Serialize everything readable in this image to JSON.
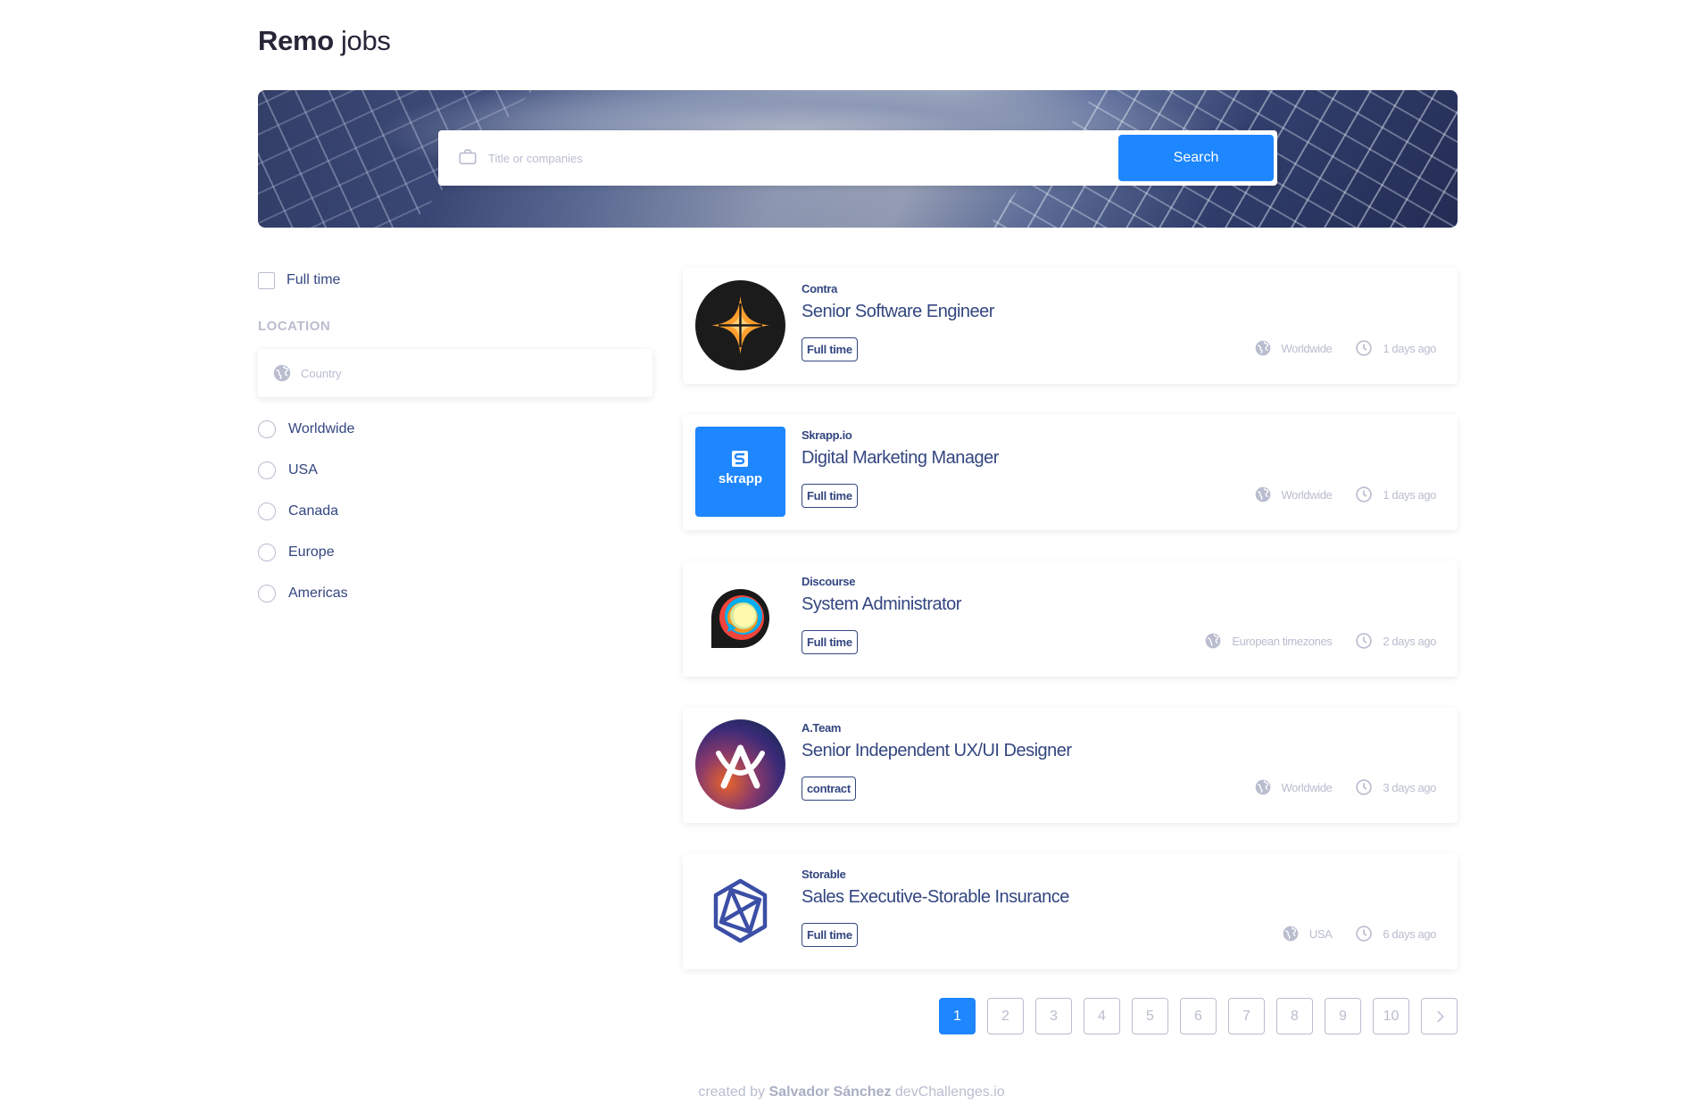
{
  "app": {
    "logo_bold": "Remo",
    "logo_light": "jobs"
  },
  "search": {
    "placeholder": "Title or companies",
    "button_label": "Search"
  },
  "filters": {
    "full_time_label": "Full time",
    "location_title": "LOCATION",
    "country_placeholder": "Country",
    "locations": [
      "Worldwide",
      "USA",
      "Canada",
      "Europe",
      "Americas"
    ]
  },
  "jobs": [
    {
      "company": "Contra",
      "title": "Senior Software Engineer",
      "tag": "Full time",
      "location": "Worldwide",
      "posted": "1  days ago",
      "logo": "contra-logo"
    },
    {
      "company": "Skrapp.io",
      "title": "Digital Marketing Manager",
      "tag": "Full time",
      "location": "Worldwide",
      "posted": "1  days ago",
      "logo": "skrapp-logo",
      "logo_text": "skrapp"
    },
    {
      "company": "Discourse",
      "title": "System Administrator",
      "tag": "Full time",
      "location": "European timezones",
      "posted": "2  days ago",
      "logo": "discourse-logo"
    },
    {
      "company": "A.Team",
      "title": "Senior Independent UX/UI Designer",
      "tag": "contract",
      "location": "Worldwide",
      "posted": "3  days ago",
      "logo": "ateam-logo"
    },
    {
      "company": "Storable",
      "title": "Sales Executive-Storable Insurance",
      "tag": "Full time",
      "location": "USA",
      "posted": "6  days ago",
      "logo": "storable-logo"
    }
  ],
  "pagination": {
    "pages": [
      "1",
      "2",
      "3",
      "4",
      "5",
      "6",
      "7",
      "8",
      "9",
      "10"
    ],
    "current": "1"
  },
  "footer": {
    "prefix": "created by",
    "author": "Salvador Sánchez",
    "suffix": "devChallenges.io"
  },
  "colors": {
    "accent": "#1e86ff",
    "text_primary": "#334680",
    "text_muted": "#b9bdcf"
  },
  "icons": {
    "search_field": "briefcase-icon",
    "location_field": "globe-icon",
    "job_location": "globe-icon",
    "job_time": "clock-icon",
    "next_page": "chevron-right-icon"
  }
}
